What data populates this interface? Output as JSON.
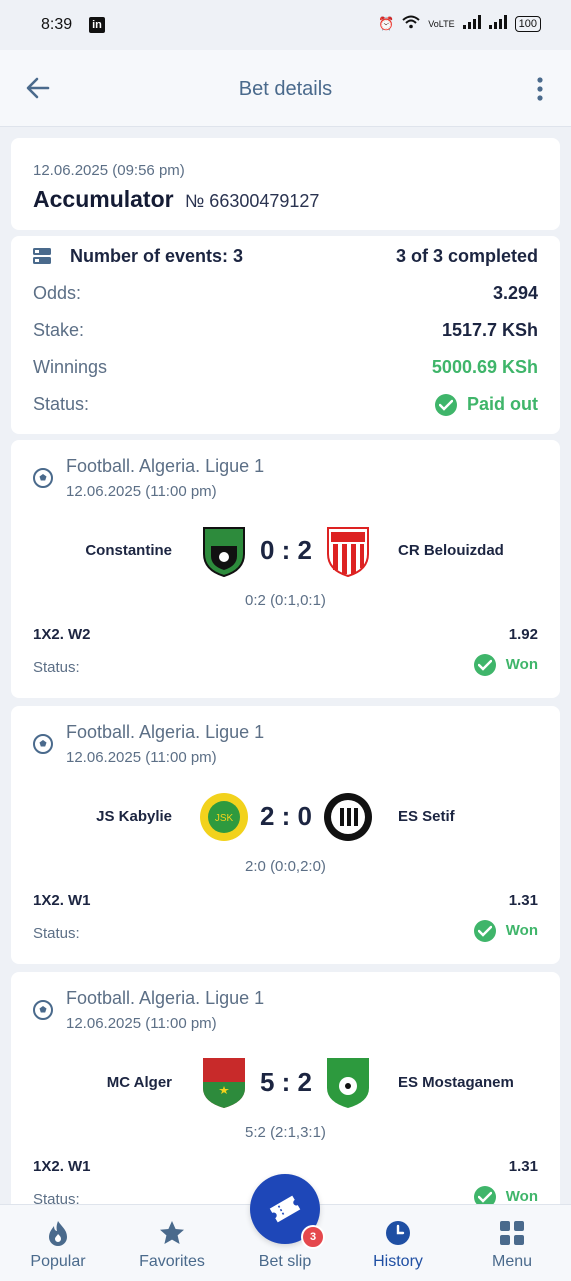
{
  "status_bar": {
    "time": "8:39",
    "network": "VoLTE",
    "battery": "100"
  },
  "appbar": {
    "title": "Bet details"
  },
  "bet": {
    "date": "12.06.2025 (09:56 pm)",
    "type": "Accumulator",
    "number": "№ 66300479127",
    "events_label": "Number of events: 3",
    "completed": "3 of 3 completed",
    "odds_label": "Odds:",
    "odds": "3.294",
    "stake_label": "Stake:",
    "stake": "1517.7 KSh",
    "winnings_label": "Winnings",
    "winnings": "5000.69 KSh",
    "status_label": "Status:",
    "status": "Paid out"
  },
  "events": [
    {
      "league": "Football. Algeria. Ligue 1",
      "date": "12.06.2025 (11:00 pm)",
      "home": "Constantine",
      "away": "CR Belouizdad",
      "score": "0 : 2",
      "period": "0:2 (0:1,0:1)",
      "market": "1X2. W2",
      "odd": "1.92",
      "status_label": "Status:",
      "status": "Won"
    },
    {
      "league": "Football. Algeria. Ligue 1",
      "date": "12.06.2025 (11:00 pm)",
      "home": "JS Kabylie",
      "away": "ES Setif",
      "score": "2 : 0",
      "period": "2:0 (0:0,2:0)",
      "market": "1X2. W1",
      "odd": "1.31",
      "status_label": "Status:",
      "status": "Won"
    },
    {
      "league": "Football. Algeria. Ligue 1",
      "date": "12.06.2025 (11:00 pm)",
      "home": "MC Alger",
      "away": "ES Mostaganem",
      "score": "5 : 2",
      "period": "5:2 (2:1,3:1)",
      "market": "1X2. W1",
      "odd": "1.31",
      "status_label": "Status:",
      "status": "Won"
    }
  ],
  "nav": {
    "popular": "Popular",
    "favorites": "Favorites",
    "betslip": "Bet slip",
    "betslip_count": "3",
    "history": "History",
    "menu": "Menu"
  },
  "colors": {
    "accent": "#1e47b8",
    "success": "#3fb56a",
    "badge": "#e5484d"
  }
}
